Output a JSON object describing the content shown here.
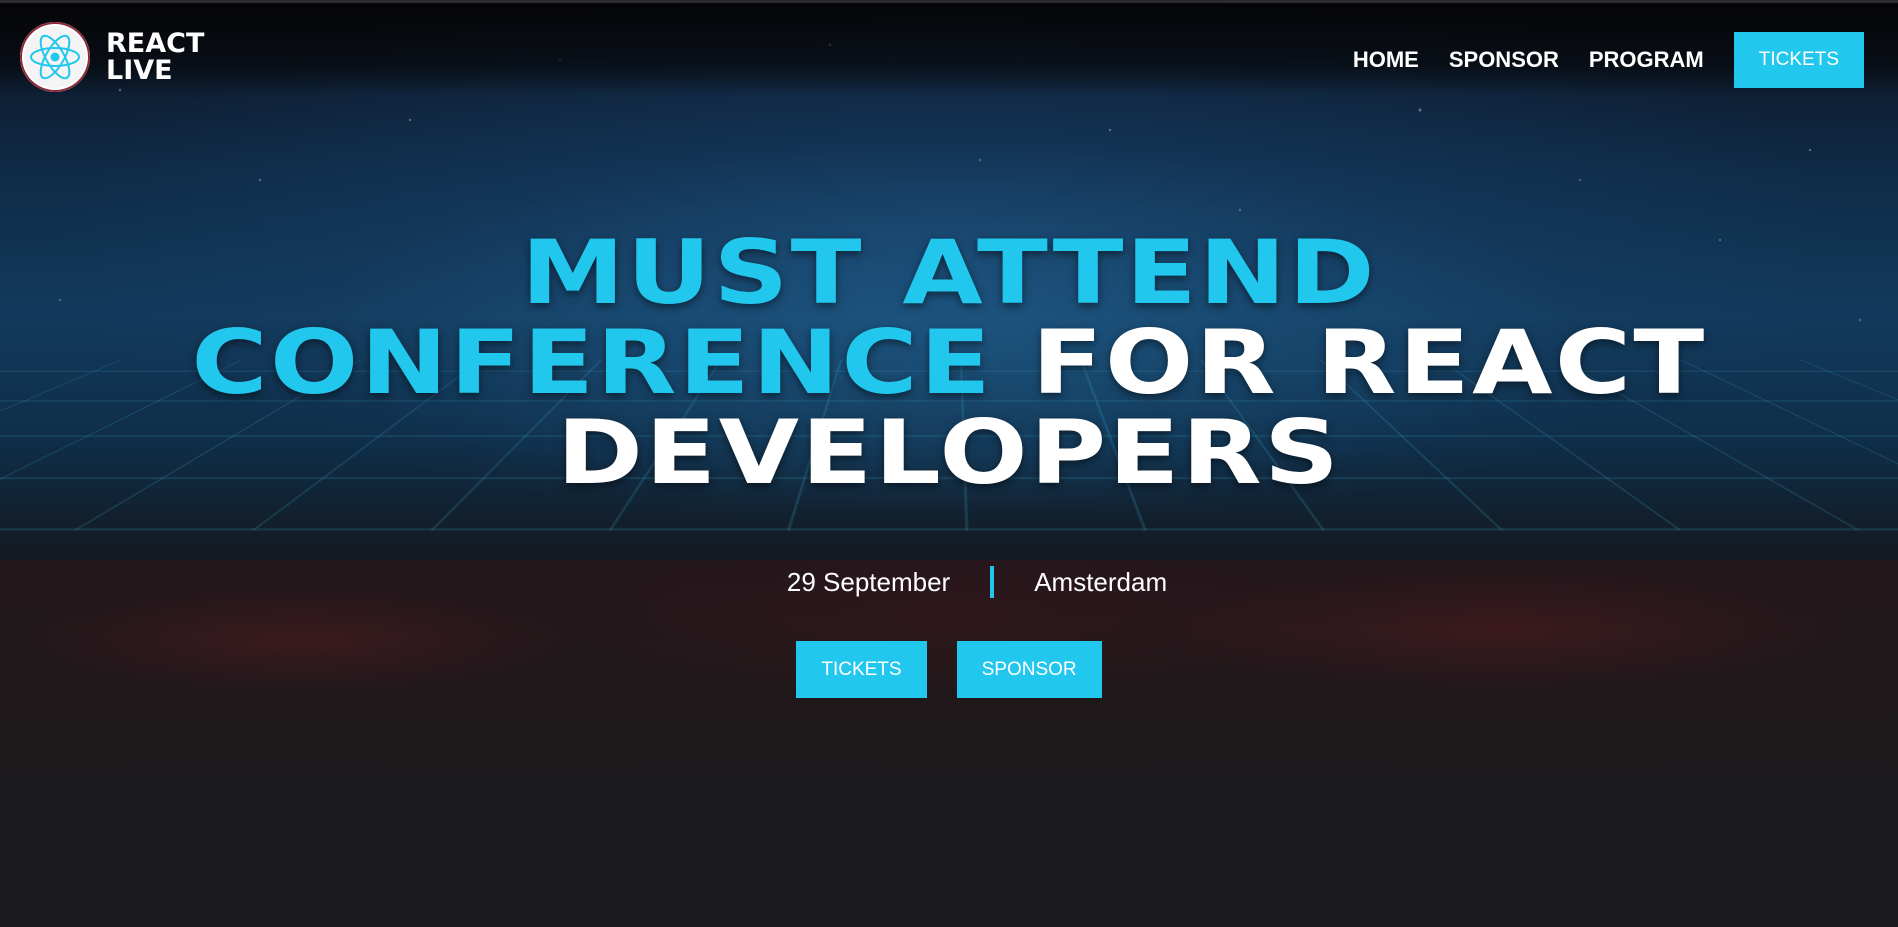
{
  "brand": {
    "logo_icon": "react-atom-icon",
    "name_line1": "REACT",
    "name_line2": "LIVE"
  },
  "nav": {
    "items": [
      {
        "label": "HOME"
      },
      {
        "label": "SPONSOR"
      },
      {
        "label": "PROGRAM"
      }
    ],
    "cta_label": "TICKETS"
  },
  "hero": {
    "headline": {
      "line1": "MUST ATTEND",
      "line2_cyan": "CONFERENCE",
      "line2_white": " FOR REACT",
      "line3": "DEVELOPERS"
    },
    "date": "29 September",
    "location": "Amsterdam",
    "buttons": {
      "tickets": "TICKETS",
      "sponsor": "SPONSOR"
    }
  },
  "colors": {
    "accent": "#22c7ee",
    "text": "#ffffff",
    "background": "#19191b"
  }
}
